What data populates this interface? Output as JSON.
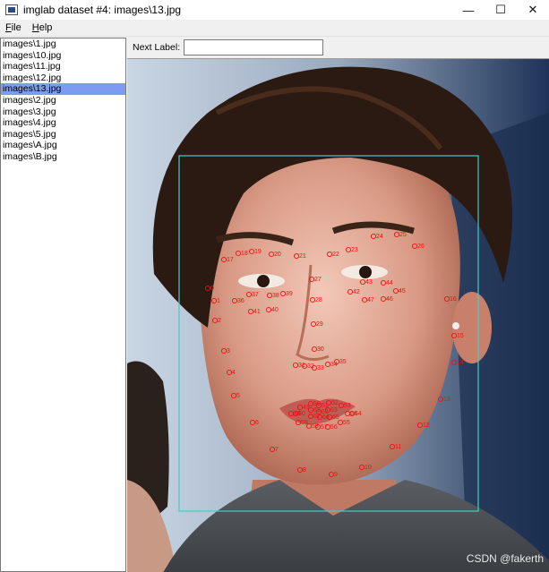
{
  "window": {
    "title": "imglab dataset #4: images\\13.jpg",
    "minimize_glyph": "—",
    "maximize_glyph": "☐",
    "close_glyph": "✕"
  },
  "menu": {
    "file": {
      "hotkey": "F",
      "rest": "ile"
    },
    "help": {
      "hotkey": "H",
      "rest": "elp"
    }
  },
  "files": [
    {
      "name": "images\\1.jpg"
    },
    {
      "name": "images\\10.jpg"
    },
    {
      "name": "images\\11.jpg"
    },
    {
      "name": "images\\12.jpg"
    },
    {
      "name": "images\\13.jpg",
      "selected": true
    },
    {
      "name": "images\\2.jpg"
    },
    {
      "name": "images\\3.jpg"
    },
    {
      "name": "images\\4.jpg"
    },
    {
      "name": "images\\5.jpg"
    },
    {
      "name": "images\\A.jpg"
    },
    {
      "name": "images\\B.jpg"
    }
  ],
  "toolbar": {
    "next_label": "Next Label:",
    "next_label_value": ""
  },
  "annotation": {
    "box_color": "#44cccc",
    "landmark_color": "#ee1111",
    "landmark_count": 68
  },
  "watermark": "CSDN @fakerth"
}
